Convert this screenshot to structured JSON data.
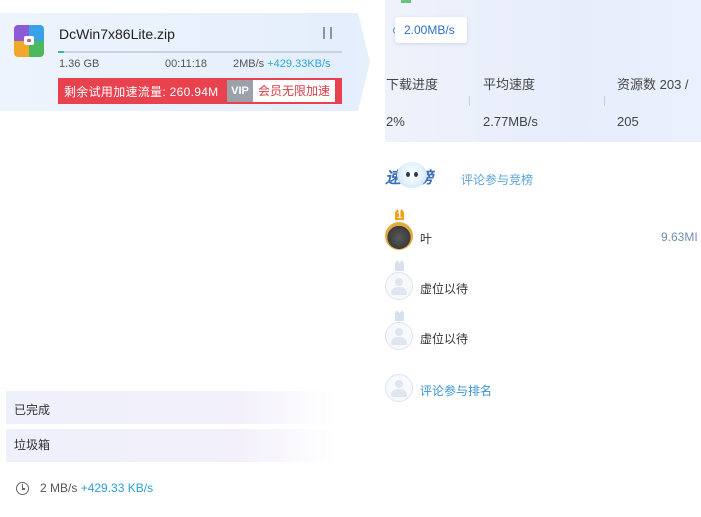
{
  "download_item": {
    "file_name": "DcWin7x86Lite.zip",
    "file_icon": "winrar-archive-icon",
    "size": "1.36 GB",
    "elapsed": "00:11:18",
    "speed": "2MB/s",
    "boost_speed": "+429.33KB/s",
    "progress": 0.02,
    "trial_remaining": "剩余试用加速流量: 260.94M",
    "vip_tag": "VIP",
    "vip_button": "会员无限加速",
    "pause_icon": "pause-icon"
  },
  "nav": {
    "completed": "已完成",
    "trash": "垃圾箱"
  },
  "footer": {
    "speed": "2 MB/s",
    "boost": "+429.33 KB/s",
    "icon": "clock-icon"
  },
  "details": {
    "chart_tooltip": "2.00MB/s",
    "stats": {
      "progress_label": "下载进度",
      "progress_value": "2%",
      "avg_speed_label": "平均速度",
      "avg_speed_value": "2.77MB/s",
      "resources_label": "资源数 203 /",
      "resources_value": "205"
    }
  },
  "ranking": {
    "title": "速度榜",
    "subtitle": "评论参与竞榜",
    "entries": [
      {
        "rank": "1",
        "name": "叶",
        "speed": "9.63MI"
      },
      {
        "rank": "",
        "name": "虚位以待",
        "speed": ""
      },
      {
        "rank": "",
        "name": "虚位以待",
        "speed": ""
      }
    ],
    "join_link": "评论参与排名"
  },
  "colors": {
    "accent_blue": "#2aa7d8",
    "promo_red": "#e8424f",
    "progress_teal": "#38b6b4",
    "crown_gold": "#f4a21c"
  }
}
